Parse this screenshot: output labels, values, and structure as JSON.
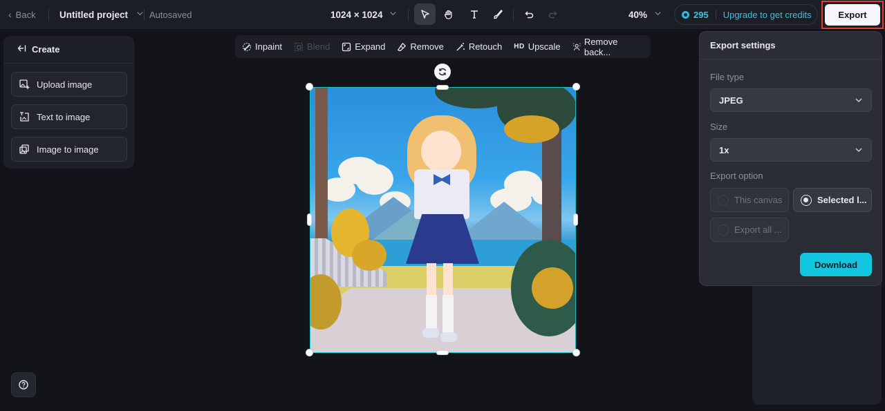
{
  "topbar": {
    "back_label": "Back",
    "project_title": "Untitled project",
    "save_status": "Autosaved",
    "canvas_size": "1024 × 1024",
    "tools": [
      {
        "name": "select",
        "icon": "cursor-icon",
        "active": true
      },
      {
        "name": "hand",
        "icon": "hand-icon",
        "active": false
      },
      {
        "name": "text",
        "icon": "text-icon",
        "active": false
      },
      {
        "name": "brush",
        "icon": "brush-icon",
        "active": false
      }
    ],
    "undo_icon": "undo-icon",
    "redo_icon": "redo-icon",
    "zoom_level": "40%",
    "credits": "295",
    "upgrade_label": "Upgrade to get credits",
    "export_label": "Export",
    "highlight_color": "#e53935"
  },
  "left_panel": {
    "title": "Create",
    "buttons": [
      {
        "label": "Upload image",
        "icon": "upload-image-icon"
      },
      {
        "label": "Text to image",
        "icon": "text-to-image-icon"
      },
      {
        "label": "Image to image",
        "icon": "image-to-image-icon"
      }
    ]
  },
  "edit_toolbar": {
    "items": [
      {
        "label": "Inpaint",
        "icon": "inpaint-icon",
        "enabled": true
      },
      {
        "label": "Blend",
        "icon": "blend-icon",
        "enabled": false
      },
      {
        "label": "Expand",
        "icon": "expand-icon",
        "enabled": true
      },
      {
        "label": "Remove",
        "icon": "eraser-icon",
        "enabled": true
      },
      {
        "label": "Retouch",
        "icon": "retouch-icon",
        "enabled": true
      },
      {
        "label": "Upscale",
        "icon": "hd-icon",
        "badge": "HD",
        "enabled": true
      },
      {
        "label": "Remove back...",
        "icon": "remove-background-icon",
        "enabled": true
      }
    ]
  },
  "canvas": {
    "image_description": "Anime girl in sailor school uniform standing on a path with mountains, lake and trees",
    "selection_color": "#17c1cc"
  },
  "export_settings": {
    "title": "Export settings",
    "file_type_label": "File type",
    "file_type_value": "JPEG",
    "size_label": "Size",
    "size_value": "1x",
    "export_option_label": "Export option",
    "options": [
      {
        "label": "This canvas",
        "selected": false
      },
      {
        "label": "Selected l...",
        "selected": true
      },
      {
        "label": "Export all ...",
        "selected": false
      }
    ],
    "download_label": "Download",
    "accent_color": "#13c6df"
  },
  "help": {
    "icon": "help-icon"
  }
}
